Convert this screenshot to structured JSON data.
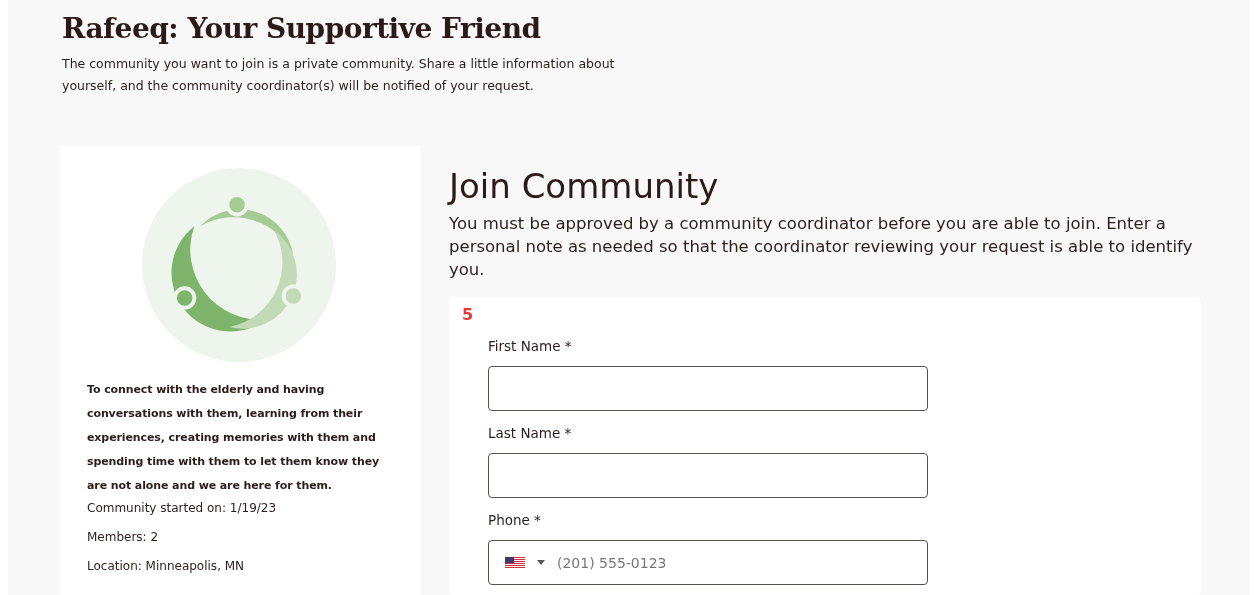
{
  "header": {
    "title": "Rafeeq: Your Supportive Friend",
    "intro": "The community you want to join is a private community. Share a little information about yourself, and the community coordinator(s) will be notified of your request."
  },
  "community": {
    "description": "To connect with the elderly and having conversations with them, learning from their experiences, creating memories with them and spending time with them to let them know they are not alone and we are here for them.",
    "details": [
      "Community started on: 1/19/23",
      "Members: 2",
      "Location: Minneapolis, MN"
    ]
  },
  "join": {
    "title": "Join Community",
    "note": "You must be approved by a community coordinator before you are able to join. Enter a personal note as needed so that the coordinator reviewing your request is able to identify you.",
    "marker": "5",
    "fields": [
      {
        "kind": "text",
        "label": "First Name *"
      },
      {
        "kind": "text",
        "label": "Last Name *"
      },
      {
        "kind": "phone",
        "label": "Phone *",
        "placeholder": "(201) 555-0123"
      }
    ]
  }
}
